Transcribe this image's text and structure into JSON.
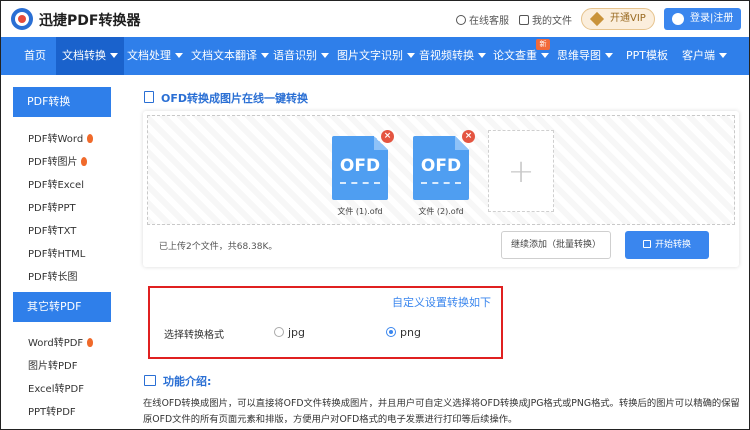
{
  "header": {
    "brand": "迅捷PDF转换器",
    "service_link": "在线客服",
    "files_link": "我的文件",
    "vip_label": "开通VIP",
    "login_label": "登录|注册"
  },
  "nav": {
    "items": [
      {
        "label": "首页",
        "caret": false
      },
      {
        "label": "文档转换",
        "caret": true
      },
      {
        "label": "文档处理",
        "caret": true
      },
      {
        "label": "文档文本翻译",
        "caret": true
      },
      {
        "label": "语音识别",
        "caret": true
      },
      {
        "label": "图片文字识别",
        "caret": true
      },
      {
        "label": "音视频转换",
        "caret": true
      },
      {
        "label": "论文查重",
        "caret": true
      },
      {
        "label": "思维导图",
        "caret": true
      },
      {
        "label": "PPT模板",
        "caret": false
      },
      {
        "label": "客户端",
        "caret": true
      }
    ],
    "new_badge": "新"
  },
  "sidebar": {
    "pdf_convert_title": "PDF转换",
    "pdf_items": [
      "PDF转Word",
      "PDF转图片",
      "PDF转Excel",
      "PDF转PPT",
      "PDF转TXT",
      "PDF转HTML",
      "PDF转长图"
    ],
    "other_title": "其它转PDF",
    "other_items": [
      "Word转PDF",
      "图片转PDF",
      "Excel转PDF",
      "PPT转PDF"
    ]
  },
  "main": {
    "title": "OFD转换成图片在线一键转换",
    "files": [
      {
        "icon_label": "OFD",
        "name": "文件 (1).ofd"
      },
      {
        "icon_label": "OFD",
        "name": "文件 (2).ofd"
      }
    ],
    "add_symbol": "+",
    "upload_info": "已上传2个文件，共68.38K。",
    "continue_button": "继续添加（批量转换）",
    "start_button": "开始转换"
  },
  "settings": {
    "title": "自定义设置转换如下",
    "format_label": "选择转换格式",
    "options": [
      {
        "label": "jpg",
        "selected": false
      },
      {
        "label": "png",
        "selected": true
      }
    ]
  },
  "intro": {
    "title": "功能介绍:",
    "text": "在线OFD转换成图片，可以直接将OFD文件转换成图片，并且用户可自定义选择将OFD转换成JPG格式或PNG格式。转换后的图片可以精确的保留原OFD文件的所有页面元素和排版，方便用户对OFD格式的电子发票进行打印等后续操作。"
  },
  "colors": {
    "nav_bg": "#2f7fea",
    "nav_active": "#1a62cc",
    "accent": "#3a86ee",
    "highlight_border": "#e02020",
    "file_icon": "#4f9ef1",
    "hot_icon": "#f06a2b"
  }
}
